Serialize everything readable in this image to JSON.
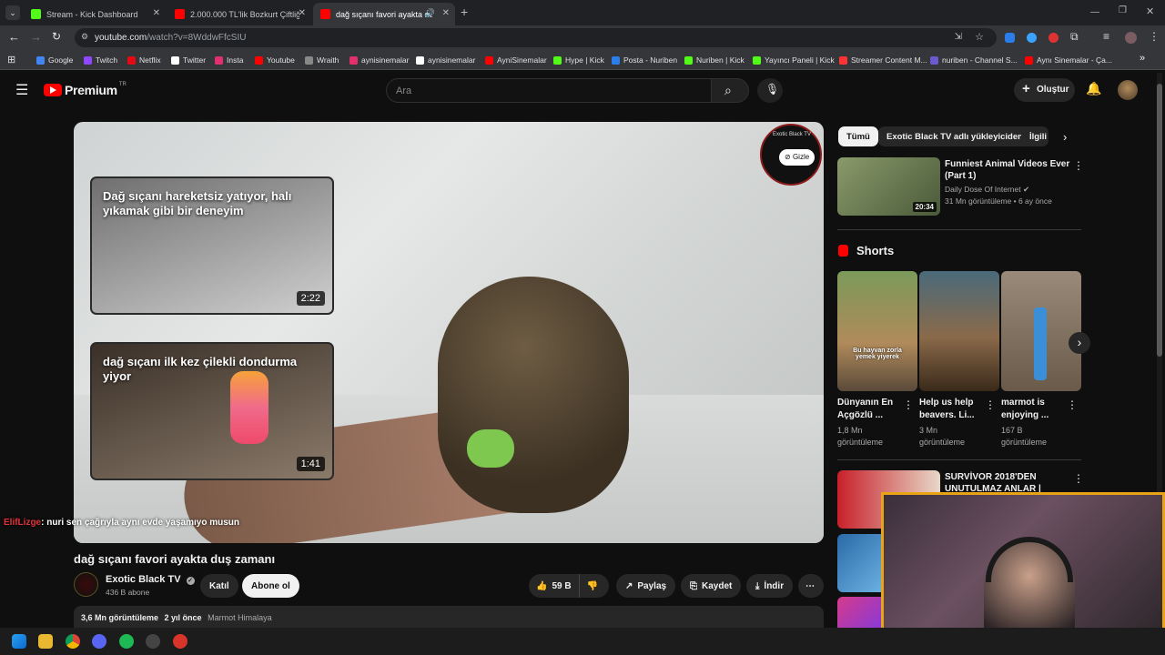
{
  "browser": {
    "tabs": [
      {
        "title": "Stream - Kick Dashboard",
        "favicon_color": "#53fc18"
      },
      {
        "title": "2.000.000 TL'lik Bozkurt Çiftliği",
        "favicon_color": "#ff0000"
      },
      {
        "title": "dağ sıçanı favori ayakta duş",
        "favicon_color": "#ff0000"
      }
    ],
    "new_tab_label": "+",
    "url_host": "youtube.com",
    "url_path": "/watch?v=8WddwFfcSIU",
    "bookmarks": [
      "Google",
      "Twitch",
      "Netflix",
      "Twitter",
      "Insta",
      "Youtube",
      "Wraith",
      "aynisinemalar",
      "aynisinemalar",
      "AyniSinemalar",
      "Hype | Kick",
      "Posta - Nuriben",
      "Nuriben | Kick",
      "Yayıncı Paneli | Kick",
      "Streamer Content M...",
      "nuriben - Channel S...",
      "Aynı Sinemalar - Ça..."
    ],
    "bookmark_more": "»"
  },
  "youtube": {
    "logo_text": "Premium",
    "logo_badge": "TR",
    "search_placeholder": "Ara",
    "create_label": "Oluştur",
    "player": {
      "end_cards": [
        {
          "title": "Dağ sıçanı hareketsiz yatıyor, halı yıkamak gibi bir deneyim",
          "duration": "2:22"
        },
        {
          "title": "dağ sıçanı ilk kez çilekli dondurma yiyor",
          "duration": "1:41"
        }
      ],
      "hide_label": "Gizle",
      "channel_watermark": "Exotic Black TV",
      "overlay_chat_user": "ElifLizge",
      "overlay_chat_text": ": nuri sen çağrıyla aynı evde yaşamıyo musun"
    },
    "video": {
      "title": "dağ sıçanı favori ayakta duş zamanı",
      "channel": "Exotic Black TV",
      "subscribers": "436 B abone",
      "join_label": "Katıl",
      "subscribe_label": "Abone ol",
      "likes": "59 B",
      "share_label": "Paylaş",
      "save_label": "Kaydet",
      "download_label": "İndir",
      "views": "3,6 Mn görüntüleme",
      "age": "2 yıl önce",
      "tag": "Marmot Himalaya"
    },
    "chips": [
      "Tümü",
      "Exotic Black TV adlı yükleyiciden",
      "İlgili"
    ],
    "recommended": [
      {
        "title": "Funniest Animal Videos Ever (Part 1)",
        "channel": "Daily Dose Of Internet",
        "views": "31 Mn görüntüleme",
        "age": "6 ay önce",
        "duration": "20:34"
      },
      {
        "title": "SURVİVOR 2018'DEN UNUTULMAZ ANLAR | Survivo..."
      }
    ],
    "shorts_label": "Shorts",
    "shorts": [
      {
        "title": "Dünyanın En Açgözlü ...",
        "views": "1,8 Mn görüntüleme",
        "caption": "Bu hayvan zorla yemek yiyerek"
      },
      {
        "title": "Help us help beavers. Li...",
        "views": "3 Mn görüntüleme"
      },
      {
        "title": "marmot is enjoying ...",
        "views": "167 B görüntüleme"
      }
    ]
  }
}
